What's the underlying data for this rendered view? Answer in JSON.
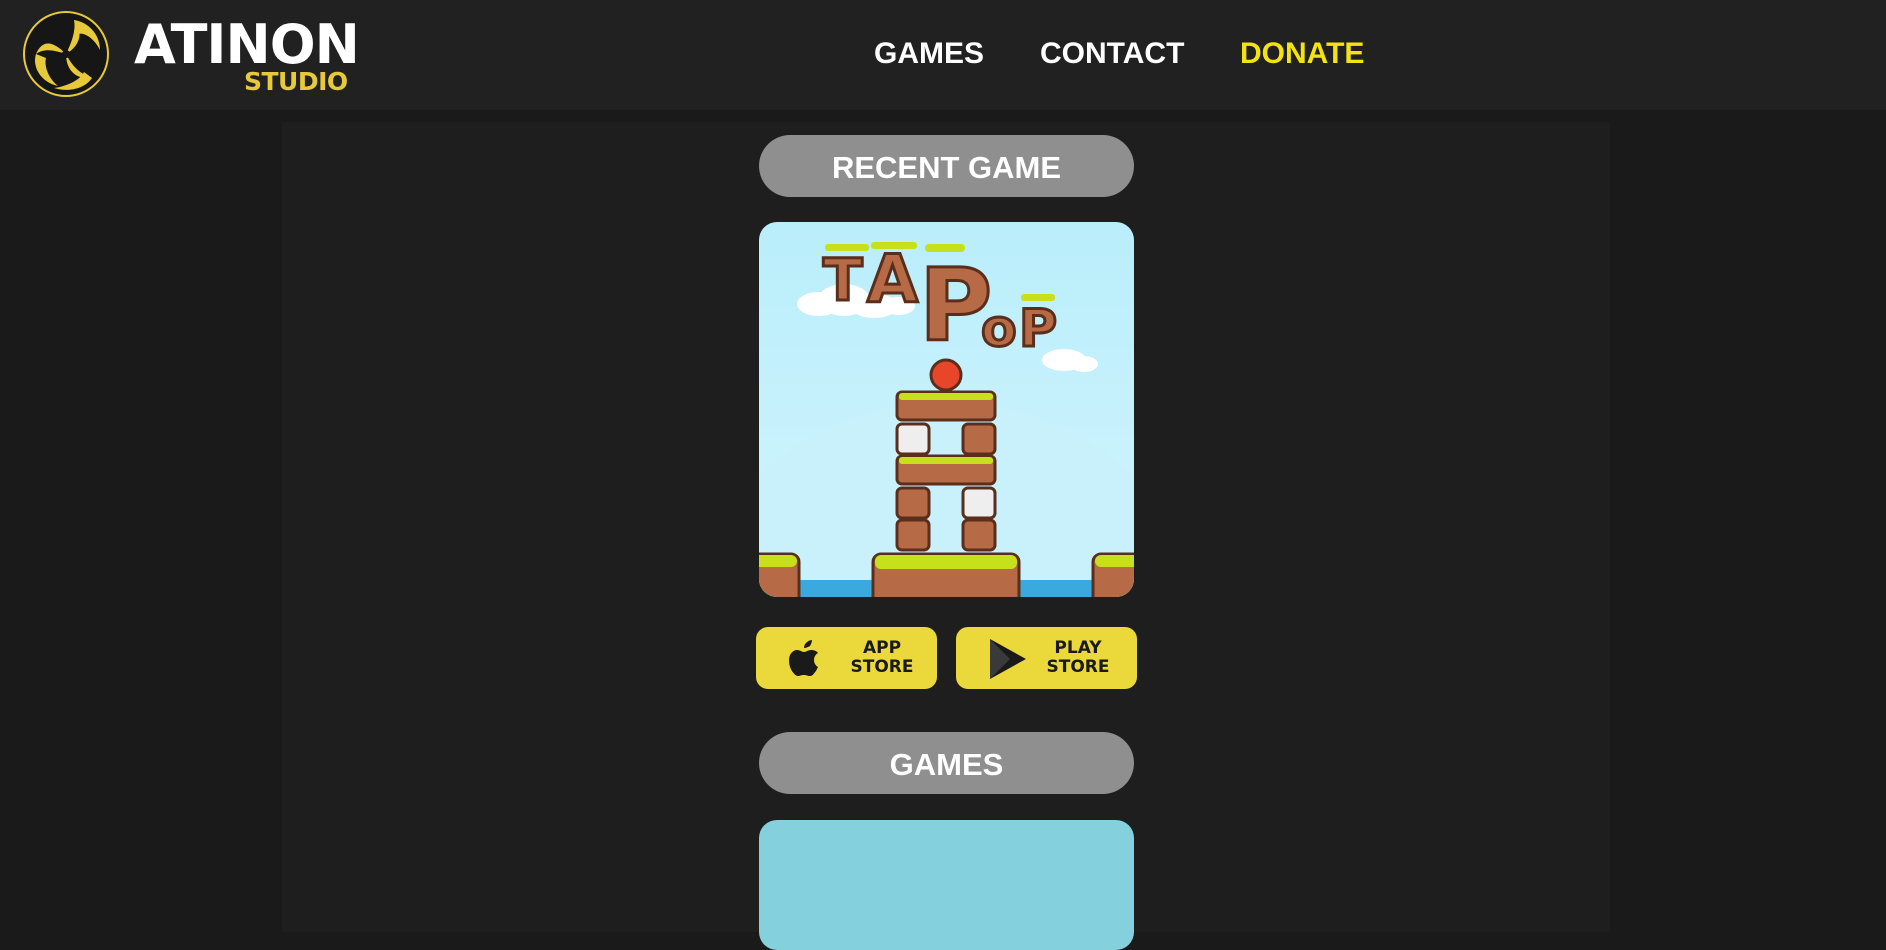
{
  "header": {
    "logo": {
      "title": "ATINON",
      "subtitle": "STUDIO",
      "icon": "triskelion-logo-icon"
    },
    "nav": [
      {
        "label": "GAMES"
      },
      {
        "label": "CONTACT"
      },
      {
        "label": "DONATE",
        "color": "#f5e311"
      }
    ]
  },
  "recent": {
    "heading": "RECENT GAME",
    "game_art_icon": "tap-pop-game-art",
    "game_title_art": "TAP Pop",
    "app_store": {
      "line1": "APP",
      "line2": "STORE",
      "icon": "apple-icon"
    },
    "play_store": {
      "line1": "PLAY",
      "line2": "STORE",
      "icon": "play-triangle-icon"
    }
  },
  "games": {
    "heading": "GAMES"
  },
  "colors": {
    "page_bg": "#1a1a1a",
    "header_bg": "#212121",
    "pill_bg": "#8f8f8f",
    "store_btn_bg": "#ebd93b",
    "accent_yellow": "#f5e311",
    "logo_gold": "#e7c93a"
  }
}
